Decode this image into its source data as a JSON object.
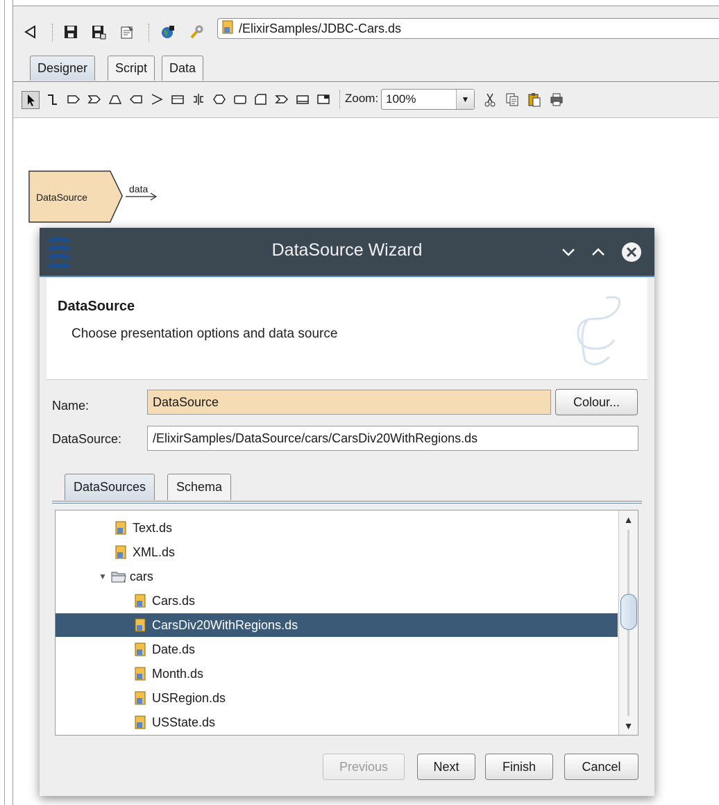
{
  "toolbar": {
    "path": "/ElixirSamples/JDBC-Cars.ds",
    "icons": [
      "back-icon",
      "save-icon",
      "save-as-icon",
      "properties-icon",
      "globe-icon",
      "wrench-icon"
    ]
  },
  "tabs": [
    {
      "label": "Designer",
      "active": true
    },
    {
      "label": "Script",
      "active": false
    },
    {
      "label": "Data",
      "active": false
    }
  ],
  "designer_toolbar": {
    "zoom_label": "Zoom:",
    "zoom_value": "100%"
  },
  "canvas": {
    "node_label": "DataSource",
    "output_label": "data"
  },
  "dialog": {
    "title": "DataSource Wizard",
    "header_title": "DataSource",
    "header_subtitle": "Choose presentation options and data source",
    "name_label": "Name:",
    "name_value": "DataSource",
    "colour_button": "Colour...",
    "datasource_label": "DataSource:",
    "datasource_value": "/ElixirSamples/DataSource/cars/CarsDiv20WithRegions.ds",
    "inner_tabs": [
      {
        "label": "DataSources",
        "active": true
      },
      {
        "label": "Schema",
        "active": false
      }
    ],
    "tree": [
      {
        "label": "Text.ds",
        "type": "file",
        "level": 2,
        "selected": false
      },
      {
        "label": "XML.ds",
        "type": "file",
        "level": 2,
        "selected": false
      },
      {
        "label": "cars",
        "type": "folder",
        "level": 1,
        "selected": false
      },
      {
        "label": "Cars.ds",
        "type": "file",
        "level": 3,
        "selected": false
      },
      {
        "label": "CarsDiv20WithRegions.ds",
        "type": "file",
        "level": 3,
        "selected": true
      },
      {
        "label": "Date.ds",
        "type": "file",
        "level": 3,
        "selected": false
      },
      {
        "label": "Month.ds",
        "type": "file",
        "level": 3,
        "selected": false
      },
      {
        "label": "USRegion.ds",
        "type": "file",
        "level": 3,
        "selected": false
      },
      {
        "label": "USState.ds",
        "type": "file",
        "level": 3,
        "selected": false
      }
    ],
    "buttons": {
      "previous": "Previous",
      "next": "Next",
      "finish": "Finish",
      "cancel": "Cancel"
    }
  },
  "colors": {
    "title_bar": "#3b4751",
    "selection": "#3a5a78",
    "name_field": "#f5dcb4",
    "node_fill": "#f5dcb4"
  }
}
